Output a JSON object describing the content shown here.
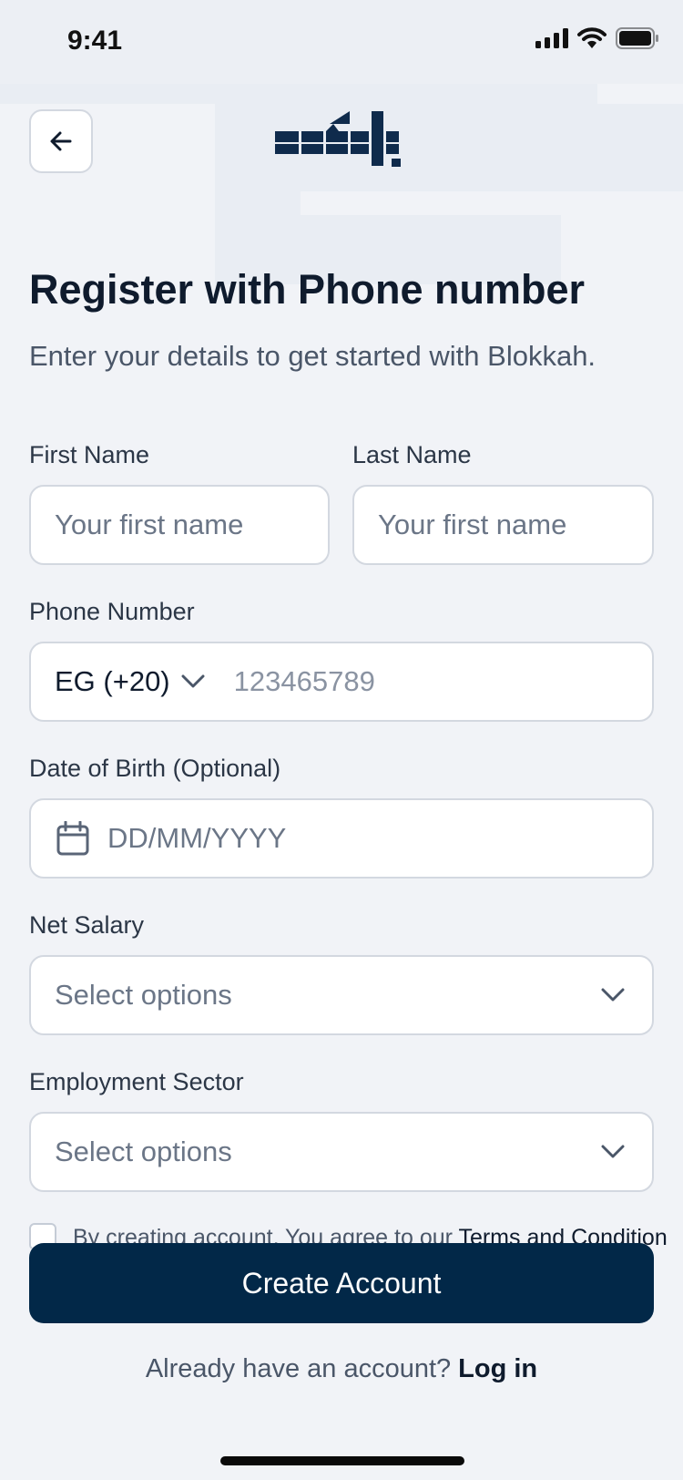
{
  "status_bar": {
    "time": "9:41"
  },
  "header": {
    "back_icon": "arrow-left-icon",
    "logo_icon": "blokkah-logo"
  },
  "title": "Register with Phone number",
  "subtitle": "Enter your details to get started with Blokkah.",
  "form": {
    "first_name": {
      "label": "First Name",
      "placeholder": "Your first name"
    },
    "last_name": {
      "label": "Last Name",
      "placeholder": "Your first name"
    },
    "phone": {
      "label": "Phone Number",
      "country_code": "EG (+20)",
      "placeholder": "123465789"
    },
    "dob": {
      "label": "Date of Birth (Optional)",
      "placeholder": "DD/MM/YYYY",
      "icon": "calendar-icon"
    },
    "net_salary": {
      "label": "Net Salary",
      "placeholder": "Select options"
    },
    "employment_sector": {
      "label": "Employment Sector",
      "placeholder": "Select options"
    }
  },
  "terms": {
    "text": "By creating account, You agree to our ",
    "link": "Terms and Conditions"
  },
  "create_button": "Create Account",
  "login": {
    "prompt": "Already have an account?",
    "link": "Log in"
  },
  "colors": {
    "primary": "#022848",
    "background": "#f1f3f7",
    "border": "#d3d8e0",
    "text": "#0f1b2d",
    "muted": "#6b7687"
  }
}
